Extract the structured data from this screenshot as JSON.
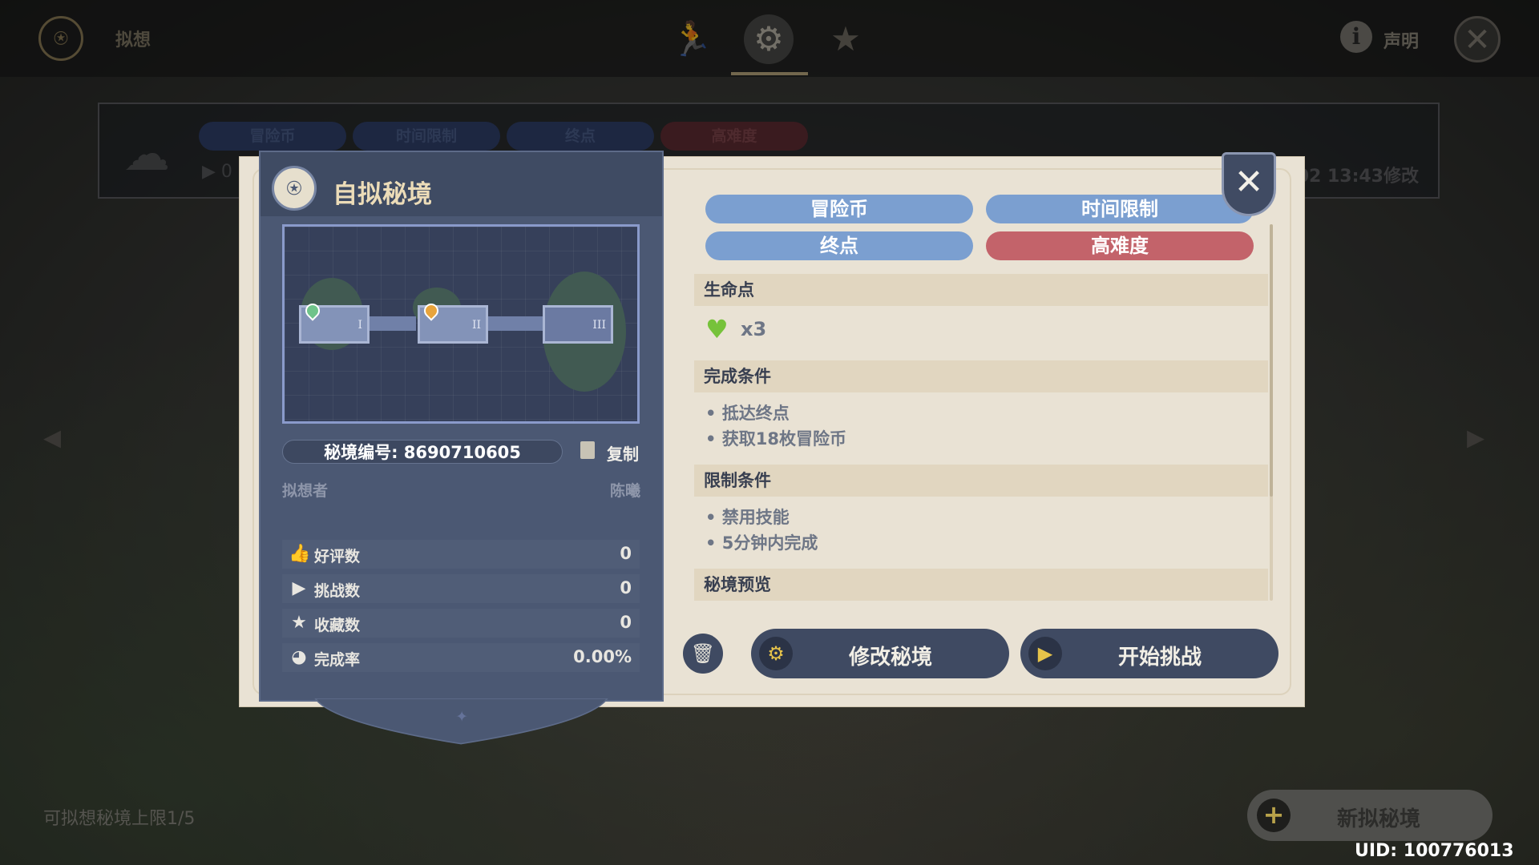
{
  "topbar": {
    "title": "拟想",
    "info_label": "声明"
  },
  "background_card": {
    "tags": [
      "冒险币",
      "时间限制",
      "终点",
      "高难度"
    ],
    "play_count_partial": "0",
    "modified_partial": "/02 13:43修改"
  },
  "dialog": {
    "title": "自拟秘境",
    "map_rooms": [
      "I",
      "II",
      "III"
    ],
    "code_label": "秘境编号: 8690710605",
    "copy_label": "复制",
    "author_label": "拟想者",
    "author_value": "陈曦",
    "stats": [
      {
        "label": "好评数",
        "value": "0",
        "icon": "thumbs-up-icon"
      },
      {
        "label": "挑战数",
        "value": "0",
        "icon": "play-icon"
      },
      {
        "label": "收藏数",
        "value": "0",
        "icon": "star-icon"
      },
      {
        "label": "完成率",
        "value": "0.00%",
        "icon": "pie-icon"
      }
    ],
    "tags": [
      {
        "label": "冒险币",
        "color": "#7b9fd0"
      },
      {
        "label": "时间限制",
        "color": "#7b9fd0"
      },
      {
        "label": "终点",
        "color": "#7b9fd0"
      },
      {
        "label": "高难度",
        "color": "#c3636a"
      }
    ],
    "hp_section": "生命点",
    "hp_value": "x3",
    "complete_section": "完成条件",
    "complete_items": [
      "抵达终点",
      "获取18枚冒险币"
    ],
    "limit_section": "限制条件",
    "limit_items": [
      "禁用技能",
      "5分钟内完成"
    ],
    "preview_section": "秘境预览",
    "edit_button": "修改秘境",
    "start_button": "开始挑战"
  },
  "bottom": {
    "limit_text": "可拟想秘境上限1/5",
    "new_button": "新拟秘境",
    "uid": "UID: 100776013"
  }
}
